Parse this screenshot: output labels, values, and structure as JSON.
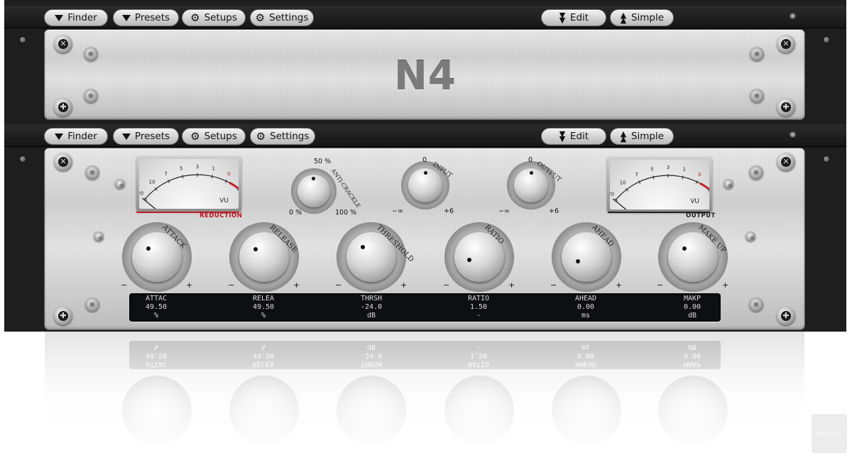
{
  "toolbar_top": {
    "finder": "Finder",
    "presets": "Presets",
    "setups": "Setups",
    "settings": "Settings",
    "edit": "Edit",
    "simple": "Simple"
  },
  "toolbar_main": {
    "finder": "Finder",
    "presets": "Presets",
    "setups": "Setups",
    "settings": "Settings",
    "edit": "Edit",
    "simple": "Simple"
  },
  "logo": "N4",
  "meters": {
    "reduction": {
      "vu_label": "VU",
      "caption": "REDUCTION",
      "scale": [
        "20",
        "10",
        "7",
        "5",
        "3",
        "1",
        "0",
        "1",
        "3"
      ],
      "needle_level": 0.05
    },
    "output": {
      "vu_label": "VU",
      "caption": "OUTPUT",
      "scale": [
        "20",
        "10",
        "7",
        "5",
        "3",
        "1",
        "0",
        "1",
        "3"
      ],
      "needle_level": 0.05
    }
  },
  "small_knobs": {
    "anti_crackle": {
      "label": "ANTI-CRACKLE",
      "top": "50 %",
      "min": "0 %",
      "max": "100 %"
    },
    "input": {
      "label": "INPUT",
      "top": "0",
      "min": "−∞",
      "max": "+6"
    },
    "output": {
      "label": "OUTPUT",
      "top": "0",
      "min": "−∞",
      "max": "+6"
    }
  },
  "big_knobs": [
    {
      "label": "ATTACK",
      "minus": "−",
      "plus": "+"
    },
    {
      "label": "RELEASE",
      "minus": "−",
      "plus": "+"
    },
    {
      "label": "THRESHOLD",
      "minus": "−",
      "plus": "+"
    },
    {
      "label": "RATIO",
      "minus": "−",
      "plus": "+"
    },
    {
      "label": "AHEAD",
      "minus": "−",
      "plus": "+"
    },
    {
      "label": "MAKE UP",
      "minus": "−",
      "plus": "+"
    }
  ],
  "display": [
    {
      "name": "ATTAC",
      "value": "49.50",
      "unit": "%"
    },
    {
      "name": "RELEA",
      "value": "49.50",
      "unit": "%"
    },
    {
      "name": "THRSH",
      "value": "-24.0",
      "unit": "dB"
    },
    {
      "name": "RATIO",
      "value": "1.50",
      "unit": "-"
    },
    {
      "name": "AHEAD",
      "value": "0.00",
      "unit": "ms"
    },
    {
      "name": "MAKP",
      "value": "0.00",
      "unit": "dB"
    }
  ],
  "watermark": "AUDIOZ",
  "colors": {
    "accent_red": "#c0202a",
    "lcd_bg": "#0e0f10",
    "lcd_text": "#d9dde0"
  }
}
